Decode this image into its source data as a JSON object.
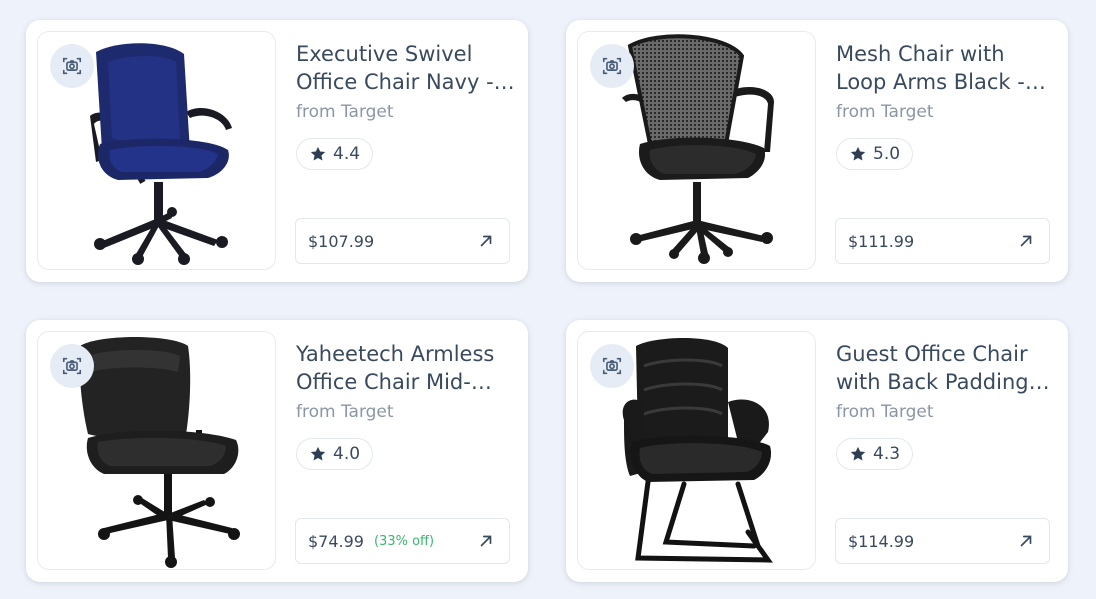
{
  "products": [
    {
      "title": "Executive Swivel Office Chair Navy - Flash Furniture",
      "source": "from Target",
      "rating": "4.4",
      "price": "$107.99",
      "discount": "",
      "image": "navy-fabric-office-chair"
    },
    {
      "title": "Mesh Chair with Loop Arms Black - Boss Office Products",
      "source": "from Target",
      "rating": "5.0",
      "price": "$111.99",
      "discount": "",
      "image": "black-mesh-office-chair"
    },
    {
      "title": "Yaheetech Armless Office Chair Mid-Back",
      "source": "from Target",
      "rating": "4.0",
      "price": "$74.99",
      "discount": "(33% off)",
      "image": "black-armless-office-chair"
    },
    {
      "title": "Guest Office Chair with Back Padding Black",
      "source": "from Target",
      "rating": "4.3",
      "price": "$114.99",
      "discount": "",
      "image": "black-leather-guest-chair"
    }
  ],
  "icons": {
    "visual_search": "camera-scan-icon",
    "rating": "star-icon",
    "open_link": "arrow-up-right-icon"
  },
  "colors": {
    "background": "#eef2fa",
    "discount": "#3cb66e",
    "star": "#2d3e55",
    "icon_bg": "#e6ecf5"
  }
}
